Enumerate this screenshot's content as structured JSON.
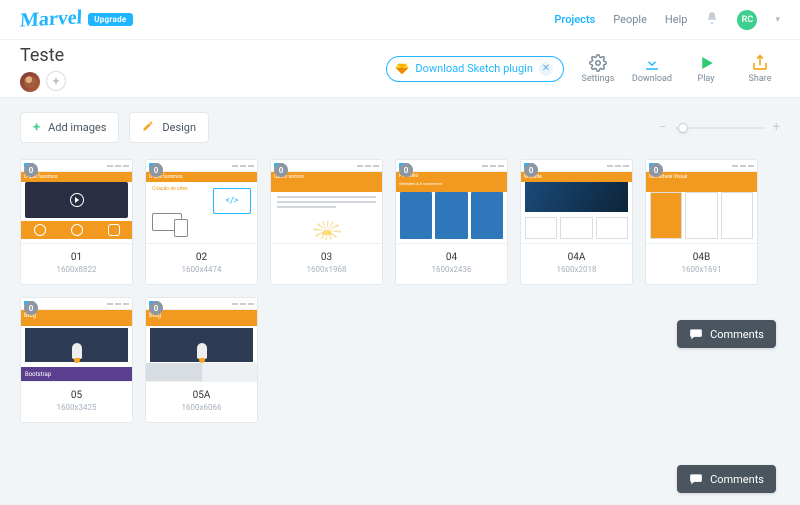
{
  "header": {
    "logo_text": "Marvel",
    "upgrade_label": "Upgrade",
    "nav": {
      "projects": "Projects",
      "people": "People",
      "help": "Help"
    },
    "avatar_initials": "RC"
  },
  "project": {
    "title": "Teste",
    "sketch_cta": "Download Sketch plugin",
    "actions": {
      "settings": "Settings",
      "download": "Download",
      "play": "Play",
      "share": "Share"
    }
  },
  "toolbar": {
    "add_images": "Add images",
    "design": "Design"
  },
  "screens": [
    {
      "name": "01",
      "dims": "1600x8822"
    },
    {
      "name": "02",
      "dims": "1600x4474"
    },
    {
      "name": "03",
      "dims": "1600x1968"
    },
    {
      "name": "04",
      "dims": "1600x2436"
    },
    {
      "name": "04A",
      "dims": "1600x2018"
    },
    {
      "name": "04B",
      "dims": "1600x1691"
    },
    {
      "name": "05",
      "dims": "1600x3425"
    },
    {
      "name": "05A",
      "dims": "1600x6066"
    }
  ],
  "badge_value": "0",
  "comments_label": "Comments",
  "thumb_text": {
    "t1": "O que fazemos",
    "t2": "Criação de sites",
    "t3": "Quem somos",
    "t4": "Portfólio",
    "t4b": "Websites & E-commerce",
    "t5": "Website",
    "t6": "Identidade Visual",
    "t7": "Blog",
    "t8": "Bootstrap"
  }
}
